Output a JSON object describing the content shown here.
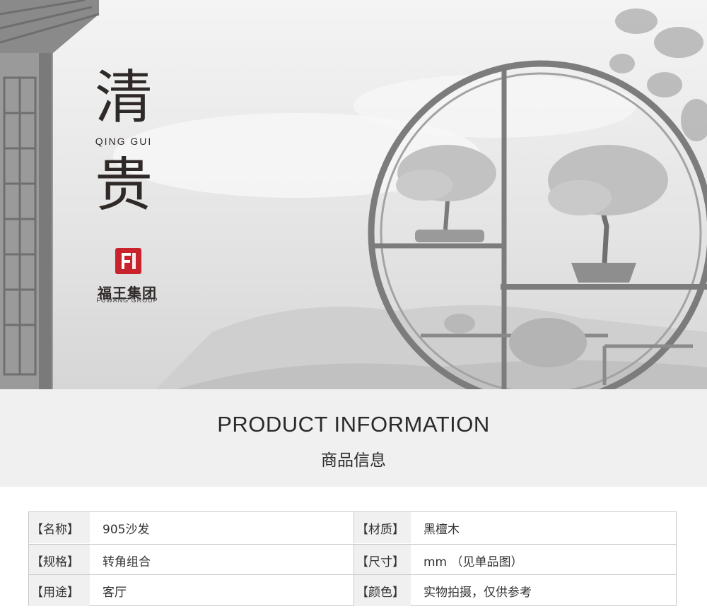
{
  "hero": {
    "title_char_1": "清",
    "title_sub": "QING GUI",
    "title_char_2": "贵",
    "brand": {
      "mark": "F",
      "name_cn": "福王集团",
      "name_en": "FUWANG GROUP",
      "color": "#c8232c"
    }
  },
  "section": {
    "title_en": "PRODUCT INFORMATION",
    "title_cn": "商品信息"
  },
  "info_table": {
    "rows": [
      {
        "label_left": "【名称】",
        "value_left": "905沙发",
        "label_right": "【材质】",
        "value_right": "黑檀木"
      },
      {
        "label_left": "【规格】",
        "value_left": "转角组合",
        "label_right": "【尺寸】",
        "value_right": "mm （见单品图）"
      },
      {
        "label_left": "【用途】",
        "value_left": "客厅",
        "label_right": "【颜色】",
        "value_right": "实物拍摄，仅供参考"
      }
    ]
  }
}
